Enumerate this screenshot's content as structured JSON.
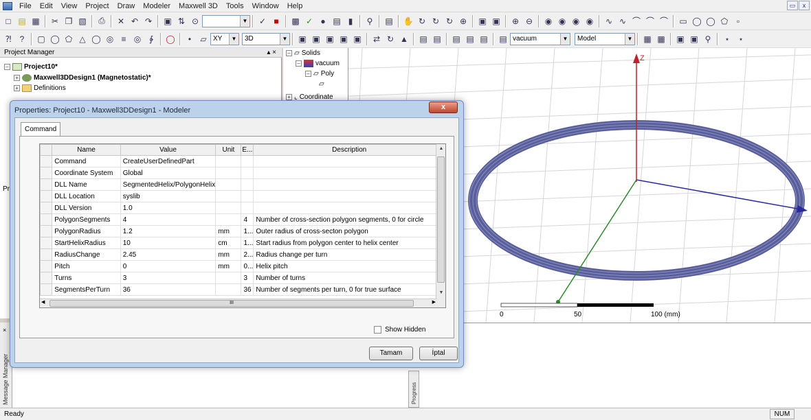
{
  "menubar": {
    "items": [
      "File",
      "Edit",
      "View",
      "Project",
      "Draw",
      "Modeler",
      "Maxwell 3D",
      "Tools",
      "Window",
      "Help"
    ]
  },
  "toolbar2": {
    "plane": "XY",
    "dim": "3D",
    "material": "vacuum",
    "model": "Model"
  },
  "project_manager": {
    "header": "Project Manager",
    "project": "Project10*",
    "design": "Maxwell3DDesign1 (Magnetostatic)*",
    "definitions": "Definitions"
  },
  "solids_panel": {
    "solids": "Solids",
    "vacuum": "vacuum",
    "poly": "Poly",
    "coordinate": "Coordinate"
  },
  "dialog": {
    "title": "Properties: Project10 - Maxwell3DDesign1 - Modeler",
    "close": "x",
    "tab": "Command",
    "headers": [
      "Name",
      "Value",
      "Unit",
      "E...",
      "Description"
    ],
    "rows": [
      {
        "name": "Command",
        "value": "CreateUserDefinedPart",
        "unit": "",
        "e": "",
        "desc": ""
      },
      {
        "name": "Coordinate System",
        "value": "Global",
        "unit": "",
        "e": "",
        "desc": ""
      },
      {
        "name": "DLL Name",
        "value": "SegmentedHelix/PolygonHelix",
        "unit": "",
        "e": "",
        "desc": ""
      },
      {
        "name": "DLL Location",
        "value": "syslib",
        "unit": "",
        "e": "",
        "desc": ""
      },
      {
        "name": "DLL Version",
        "value": "1.0",
        "unit": "",
        "e": "",
        "desc": ""
      },
      {
        "name": "PolygonSegments",
        "value": "4",
        "unit": "",
        "e": "4",
        "desc": "Number of cross-section polygon segments, 0 for circle"
      },
      {
        "name": "PolygonRadius",
        "value": "1.2",
        "unit": "mm",
        "e": "1...",
        "desc": "Outer radius of cross-secton polygon"
      },
      {
        "name": "StartHelixRadius",
        "value": "10",
        "unit": "cm",
        "e": "1...",
        "desc": "Start radius from polygon center to helix center"
      },
      {
        "name": "RadiusChange",
        "value": "2.45",
        "unit": "mm",
        "e": "2...",
        "desc": "Radius change per turn"
      },
      {
        "name": "Pitch",
        "value": "0",
        "unit": "mm",
        "e": "0...",
        "desc": "Helix pitch"
      },
      {
        "name": "Turns",
        "value": "3",
        "unit": "",
        "e": "3",
        "desc": "Number of turns"
      },
      {
        "name": "SegmentsPerTurn",
        "value": "36",
        "unit": "",
        "e": "36",
        "desc": "Number of segments per turn, 0 for true surface"
      }
    ],
    "show_hidden": "Show Hidden",
    "ok": "Tamam",
    "cancel": "İptal",
    "hscroll_grip": "III"
  },
  "viewport": {
    "axis_z": "Z",
    "scale": [
      "0",
      "50",
      "100 (mm)"
    ]
  },
  "side_tabs": {
    "message_manager": "Message Manager",
    "progress": "Progress",
    "pr": "Pr"
  },
  "statusbar": {
    "left": "Ready",
    "num": "NUM"
  },
  "colors": {
    "coil": "#5a5f9a",
    "axis_x": "#2a2aa0",
    "axis_y": "#2a8a2a",
    "axis_z": "#c0202a"
  }
}
